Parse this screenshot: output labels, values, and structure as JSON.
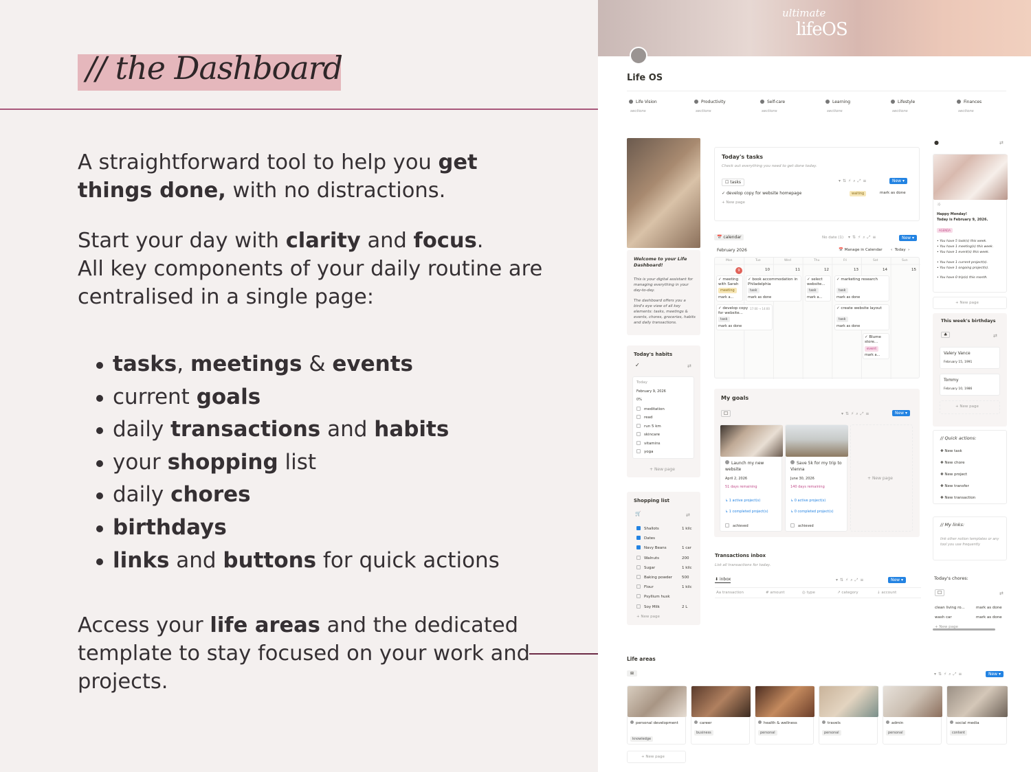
{
  "left": {
    "title": "// the Dashboard",
    "p1": {
      "a": "A straightforward tool to help you ",
      "b": "get",
      "c": "things done,",
      "d": " with no distractions."
    },
    "p2": {
      "a": "Start your day with ",
      "b": "clarity",
      "c": " and ",
      "d": "focus",
      "e": ".",
      "line2": "All key components of your daily routine are",
      "line3": "centralised in a single page:"
    },
    "bullets": [
      {
        "b1": "tasks",
        "t1": ", ",
        "b2": "meetings",
        "t2": " & ",
        "b3": "events"
      },
      {
        "t1": "current ",
        "b1": "goals"
      },
      {
        "t1": "daily ",
        "b1": "transactions",
        "t2": " and ",
        "b2": "habits"
      },
      {
        "t1": "your ",
        "b1": "shopping",
        "t2": " list"
      },
      {
        "t1": "daily ",
        "b1": "chores"
      },
      {
        "b1": "birthdays"
      },
      {
        "b1": "links",
        "t1": " and ",
        "b2": "buttons",
        "t2": " for quick actions"
      }
    ],
    "p3": {
      "a": "Access your ",
      "b": "life areas",
      "c": " and the dedicated",
      "line2": "template to stay focused on your work and",
      "line3": "projects."
    }
  },
  "app": {
    "logo_script": "ultimate",
    "logo_main": "lifeOS",
    "page_title": "Life OS",
    "areas": [
      {
        "name": "Life Vision",
        "sub": "sections"
      },
      {
        "name": "Productivity",
        "sub": "sections"
      },
      {
        "name": "Self-care",
        "sub": "sections"
      },
      {
        "name": "Learning",
        "sub": "sections"
      },
      {
        "name": "Lifestyle",
        "sub": "sections"
      },
      {
        "name": "Finances",
        "sub": "sections"
      }
    ],
    "welcome": {
      "title": "Welcome to your Life Dashboard!",
      "p1": "This is your digital assistant for managing everything in your day-to-day.",
      "p2": "The dashboard offers you a bird's eye view of all key elements: tasks, meetings & events, chores, groceries, habits and daily transactions."
    },
    "tasks": {
      "title": "Today's tasks",
      "desc": "Check out everything you need to get done today.",
      "view": "tasks",
      "new": "New",
      "item": "develop copy for website homepage",
      "status": "waiting",
      "action": "mark as done",
      "new_page": "New page"
    },
    "calendar": {
      "view": "calendar",
      "nodate": "No date (1)",
      "new": "New",
      "month": "February 2026",
      "manage": "Manage in Calendar",
      "today": "Today",
      "days": [
        "Mon",
        "Tue",
        "Wed",
        "Thu",
        "Fri",
        "Sat",
        "Sun"
      ],
      "dates": [
        "9",
        "10",
        "11",
        "12",
        "13",
        "14",
        "15"
      ],
      "e1": "meeting with Sarah",
      "e1tag": "meeting",
      "e1act": "mark a...",
      "e2": "develop copy for website...",
      "e2time": "17:00 → 14:00",
      "e2tag": "task",
      "e2act": "mark as done",
      "e3": "book accommodation in Philadelphia",
      "e3tag": "task",
      "e3act": "mark as done",
      "e4": "select website...",
      "e4tag": "task",
      "e4act": "mark a...",
      "e5": "marketing research",
      "e5tag": "task",
      "e5act": "mark as done",
      "e6": "create website layout",
      "e6tag": "task",
      "e6act": "mark as done",
      "e7": "Blume store...",
      "e7tag": "event",
      "e7act": "mark a..."
    },
    "habits": {
      "title": "Today's habits",
      "today": "Today",
      "date": "February 9, 2026",
      "pct": "0%",
      "items": [
        "meditation",
        "read",
        "run 5 km",
        "skincare",
        "vitamins",
        "yoga"
      ],
      "new_page": "New page"
    },
    "goals": {
      "title": "My goals",
      "new": "New",
      "g1": {
        "name": "Launch my new website",
        "date": "April 2, 2026",
        "remain": "51 days remaining",
        "active": "1 active project(s)",
        "done": "1 completed project(s)",
        "ach": "achieved"
      },
      "g2": {
        "name": "Save 5k for my trip to Vienna",
        "date": "June 30, 2026",
        "remain": "140 days remaining",
        "active": "0 active project(s)",
        "done": "0 completed project(s)",
        "ach": "achieved"
      },
      "new_page": "New page"
    },
    "shopping": {
      "title": "Shopping list",
      "items": [
        {
          "name": "Shallots",
          "qty": "1 kilc",
          "on": true
        },
        {
          "name": "Dates",
          "qty": "",
          "on": true
        },
        {
          "name": "Navy Beans",
          "qty": "1 car",
          "on": true
        },
        {
          "name": "Walnuts",
          "qty": "200",
          "on": false
        },
        {
          "name": "Sugar",
          "qty": "1 kilc",
          "on": false
        },
        {
          "name": "Baking powder",
          "qty": "500",
          "on": false
        },
        {
          "name": "Flour",
          "qty": "1 kilc",
          "on": false
        },
        {
          "name": "Psyllium husk",
          "qty": "",
          "on": false
        },
        {
          "name": "Soy Milk",
          "qty": "2 L",
          "on": false
        }
      ],
      "new_page": "New page"
    },
    "transactions": {
      "title": "Transactions inbox",
      "desc": "List all transactions for today.",
      "view": "inbox",
      "new": "New",
      "cols": [
        "transaction",
        "amount",
        "type",
        "category",
        "account"
      ]
    },
    "rightcol": {
      "greet": "Happy Monday!",
      "date": "Today is February 9, 2026.",
      "tag": "AGENDA",
      "lines": [
        "You have 5 task(s) this week.",
        "You have 1 meeting(s) this week.",
        "You have 1 event(s) this week.",
        "You have 1 current project(s).",
        "You have 1 ongoing project(s).",
        "You have 0 trip(s) this month."
      ],
      "new_page": "New page",
      "bday_title": "This week's birthdays",
      "b1": {
        "name": "Valery Vance",
        "date": "February 15, 1991"
      },
      "b2": {
        "name": "Tommy",
        "date": "February 10, 1986"
      },
      "quick_title": "// Quick actions:",
      "quick": [
        "New task",
        "New chore",
        "New project",
        "New transfer",
        "New transaction"
      ],
      "links_title": "// My links:",
      "links_desc": "link other notion templates or any tool you use frequently",
      "chores_title": "Today's chores:",
      "chores": [
        {
          "name": "clean living ro...",
          "act": "mark as done"
        },
        {
          "name": "wash car",
          "act": "mark as done"
        }
      ],
      "chores_new": "New page"
    },
    "lifeareas": {
      "title": "Life areas",
      "new": "New",
      "items": [
        {
          "name": "personal development",
          "tag": "knowledge"
        },
        {
          "name": "career",
          "tag": "business"
        },
        {
          "name": "health & wellness",
          "tag": "personal"
        },
        {
          "name": "travels",
          "tag": "personal"
        },
        {
          "name": "admin",
          "tag": "personal"
        },
        {
          "name": "social media",
          "tag": "content"
        }
      ],
      "new_page": "New page"
    }
  }
}
